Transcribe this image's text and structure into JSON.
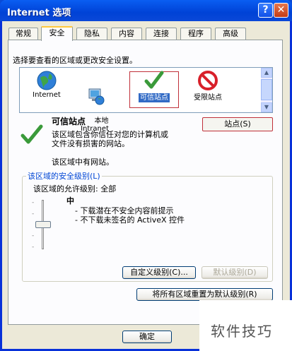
{
  "window": {
    "title": "Internet 选项"
  },
  "title_buttons": {
    "help": "?",
    "close": "✕"
  },
  "tabs": [
    "常规",
    "安全",
    "隐私",
    "内容",
    "连接",
    "程序",
    "高级"
  ],
  "active_tab": "安全",
  "zone_prompt": "选择要查看的区域或更改安全设置。",
  "zones": [
    {
      "label": "Internet",
      "icon": "globe-icon"
    },
    {
      "label": "本地\nIntranet",
      "icon": "intranet-icon"
    },
    {
      "label": "可信站点",
      "icon": "checkmark-icon",
      "selected": true
    },
    {
      "label": "受限站点",
      "icon": "restricted-icon"
    }
  ],
  "selected_zone": {
    "title": "可信站点",
    "sites_button": "站点(S)",
    "description_line1": "该区域包含你信任对您的计算机或",
    "description_line2": "文件没有损害的网站。",
    "no_sites": "该区域中有网站。"
  },
  "security_level": {
    "group_title": "该区域的安全级别(L)",
    "allowed": "该区域的允许级别: 全部",
    "level": "中",
    "bullet1": "- 下载潜在不安全内容前提示",
    "bullet2": "- 不下载未签名的 ActiveX 控件",
    "custom_button": "自定义级别(C)...",
    "default_button": "默认级别(D)",
    "reset_all_button": "将所有区域重置为默认级别(R)"
  },
  "footer": {
    "ok_button": "确定"
  },
  "watermark": "软件技巧"
}
